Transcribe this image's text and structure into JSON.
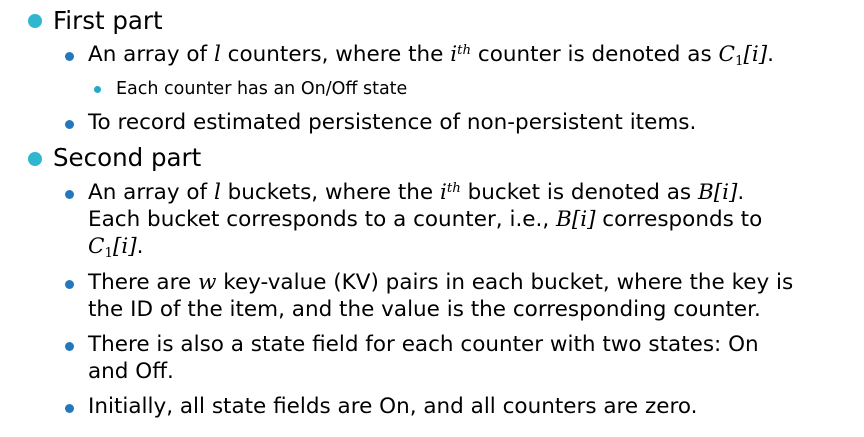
{
  "bullets": {
    "first_part": {
      "label": "First part",
      "items": {
        "counters": {
          "t1": "An array of ",
          "l": "l",
          "t2": " counters, where the ",
          "i": "i",
          "th": "th",
          "t3": " counter is denoted as ",
          "c": "C",
          "sub1": "1",
          "bracket": "[i]",
          "t4": ".",
          "sub_bullet": "Each counter has an On/Off state"
        },
        "record": "To record estimated persistence of non-persistent items."
      }
    },
    "second_part": {
      "label": "Second part",
      "items": {
        "buckets": {
          "line1_t1": "An array of ",
          "line1_l": "l",
          "line1_t2": " buckets, where the ",
          "line1_i": "i",
          "line1_th": "th",
          "line1_t3": " bucket is denoted as ",
          "line1_b": "B[i]",
          "line1_t4": ".",
          "line2_t1": "Each bucket corresponds to a counter, i.e., ",
          "line2_b": "B[i]",
          "line2_t2": " corresponds to",
          "line3_c": "C",
          "line3_sub": "1",
          "line3_bracket": "[i]",
          "line3_t": "."
        },
        "kv": {
          "line1_t1": "There are ",
          "line1_w": "w",
          "line1_t2": " key-value (KV) pairs in each bucket, where the key is",
          "line2": "the ID of the item, and the value is the corresponding counter."
        },
        "state_field": {
          "line1": "There is also a state field for each counter with two states: On",
          "line2": "and Off."
        },
        "initially": "Initially, all state fields are On, and all counters are zero."
      }
    }
  },
  "colors": {
    "level1_bullet": "#2fb7cf",
    "level2_bullet": "#2277bd",
    "level3_bullet": "#28a8c8"
  }
}
